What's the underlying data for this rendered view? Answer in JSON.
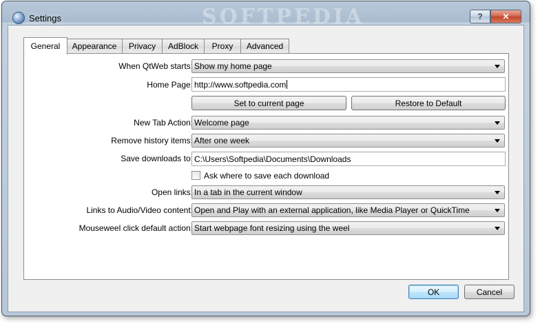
{
  "window": {
    "title": "Settings",
    "watermark": "SOFTPEDIA",
    "help_label": "?",
    "close_label": "✕"
  },
  "tabs": [
    {
      "label": "General",
      "active": true
    },
    {
      "label": "Appearance",
      "active": false
    },
    {
      "label": "Privacy",
      "active": false
    },
    {
      "label": "AdBlock",
      "active": false
    },
    {
      "label": "Proxy",
      "active": false
    },
    {
      "label": "Advanced",
      "active": false
    }
  ],
  "general": {
    "when_starts_label": "When QtWeb starts:",
    "when_starts_value": "Show my home page",
    "home_page_label": "Home Page:",
    "home_page_value": "http://www.softpedia.com",
    "set_current_label": "Set to current page",
    "restore_default_label": "Restore to Default",
    "new_tab_label": "New Tab Action:",
    "new_tab_value": "Welcome page",
    "remove_history_label": "Remove history items:",
    "remove_history_value": "After one week",
    "save_downloads_label": "Save downloads to:",
    "save_downloads_value": "C:\\Users\\Softpedia\\Documents\\Downloads",
    "ask_where_label": "Ask where to save each download",
    "ask_where_checked": false,
    "open_links_label": "Open links:",
    "open_links_value": "In a tab in the current window",
    "av_links_label": "Links to Audio/Video content:",
    "av_links_value": "Open and Play with an external application, like Media Player or QuickTime",
    "mousewheel_label": "Mouseweel click default action:",
    "mousewheel_value": "Start webpage font resizing using the weel"
  },
  "footer": {
    "ok_label": "OK",
    "cancel_label": "Cancel"
  }
}
